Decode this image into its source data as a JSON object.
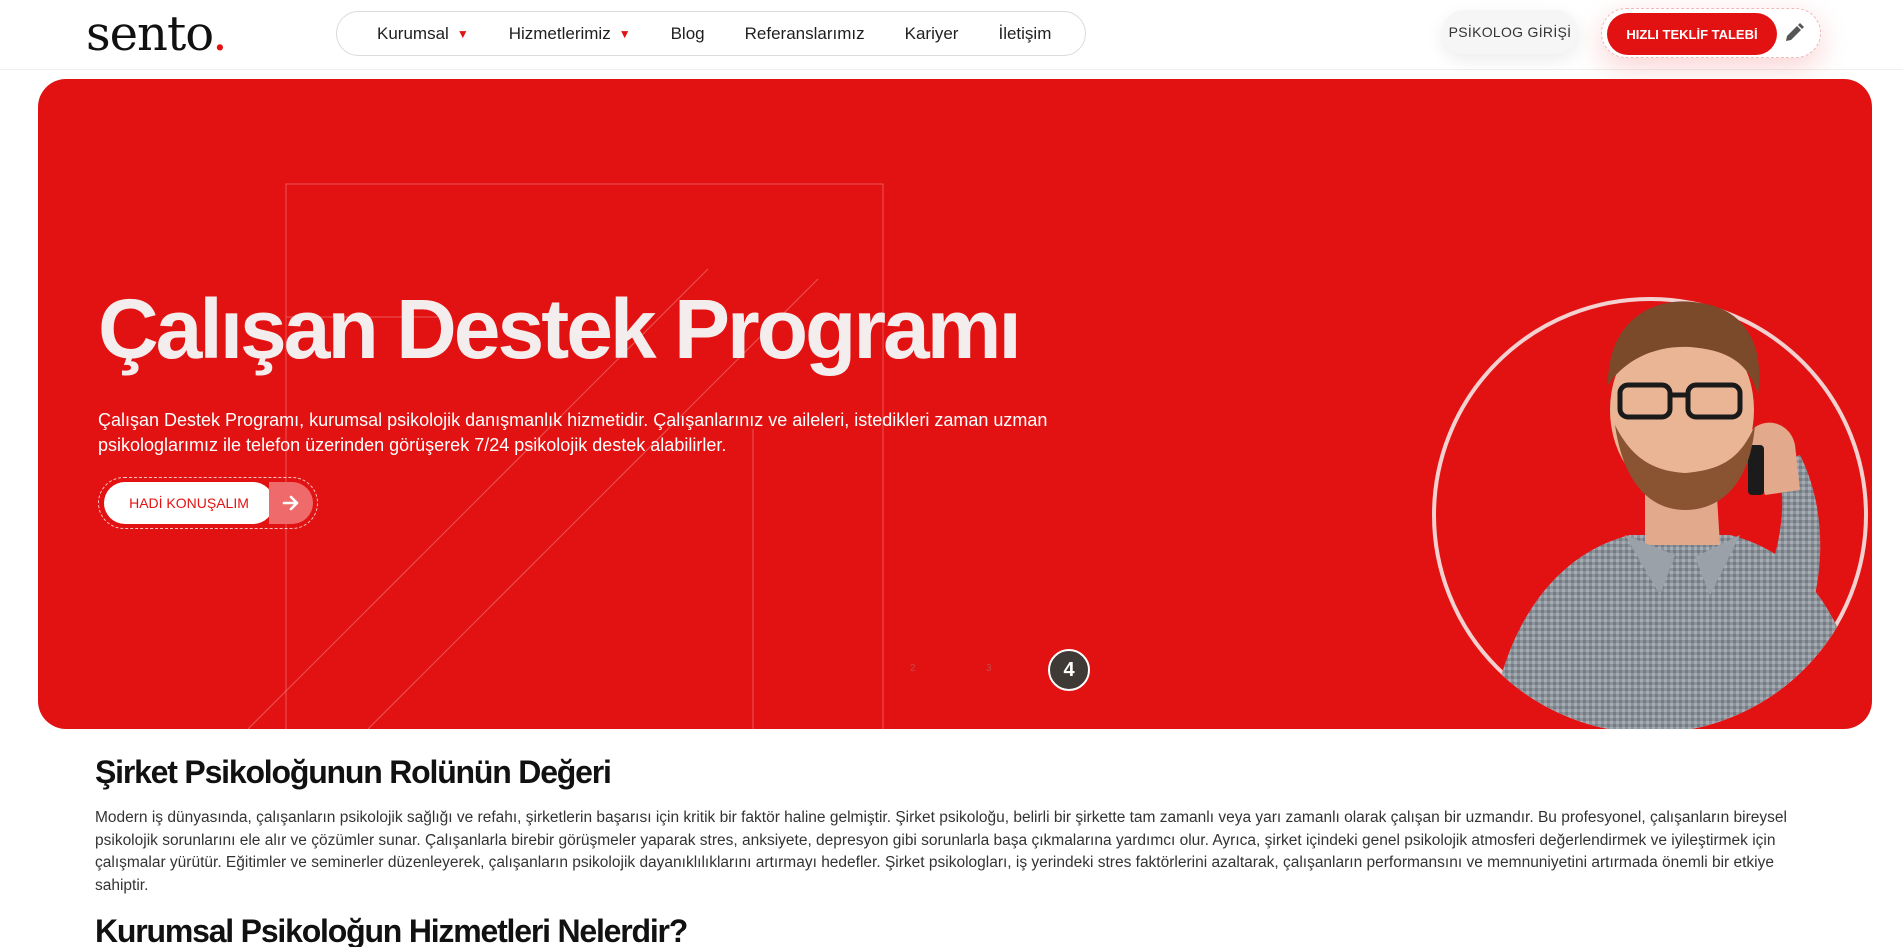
{
  "header": {
    "logo_text": "sento",
    "logo_dot": ".",
    "nav": [
      {
        "label": "Kurumsal",
        "has_dropdown": true
      },
      {
        "label": "Hizmetlerimiz",
        "has_dropdown": true
      },
      {
        "label": "Blog",
        "has_dropdown": false
      },
      {
        "label": "Referanslarımız",
        "has_dropdown": false
      },
      {
        "label": "Kariyer",
        "has_dropdown": false
      },
      {
        "label": "İletişim",
        "has_dropdown": false
      }
    ],
    "dropdown_glyph": "⌄",
    "psikolog_login": "PSİKOLOG GİRİŞİ",
    "quote_cta": "HIZLI TEKLİF TALEBİ",
    "quote_icon": "pencil-icon"
  },
  "hero": {
    "title": "Çalışan Destek Programı",
    "description": "Çalışan Destek Programı, kurumsal psikolojik danışmanlık hizmetidir. Çalışanlarınız ve aileleri, istedikleri zaman uzman psikologlarımız ile telefon üzerinden görüşerek 7/24 psikolojik destek alabilirler.",
    "cta": "HADİ KONUŞALIM",
    "cta_icon": "arrow-right-icon",
    "slides": [
      {
        "label": "2",
        "active": false
      },
      {
        "label": "3",
        "active": false
      },
      {
        "label": "4",
        "active": true
      }
    ],
    "image": "man-on-phone-portrait"
  },
  "content": {
    "section1_title": "Şirket Psikoloğunun Rolünün Değeri",
    "section1_body": "Modern iş dünyasında, çalışanların psikolojik sağlığı ve refahı, şirketlerin başarısı için kritik bir faktör haline gelmiştir. Şirket psikoloğu, belirli bir şirkette tam zamanlı veya yarı zamanlı olarak çalışan bir uzmandır. Bu profesyonel, çalışanların bireysel psikolojik sorunlarını ele alır ve çözümler sunar. Çalışanlarla birebir görüşmeler yaparak stres, anksiyete, depresyon gibi sorunlarla başa çıkmalarına yardımcı olur. Ayrıca, şirket içindeki genel psikolojik atmosferi değerlendirmek ve iyileştirmek için çalışmalar yürütür. Eğitimler ve seminerler düzenleyerek, çalışanların psikolojik dayanıklılıklarını artırmayı hedefler. Şirket psikologları, iş yerindeki stres faktörlerini azaltarak, çalışanların performansını ve memnuniyetini artırmada önemli bir etkiye sahiptir.",
    "section2_title": "Kurumsal Psikoloğun Hizmetleri Nelerdir?"
  },
  "colors": {
    "brand_red": "#e31212",
    "text_dark": "#111111",
    "slide_active": "#3f3a36"
  }
}
